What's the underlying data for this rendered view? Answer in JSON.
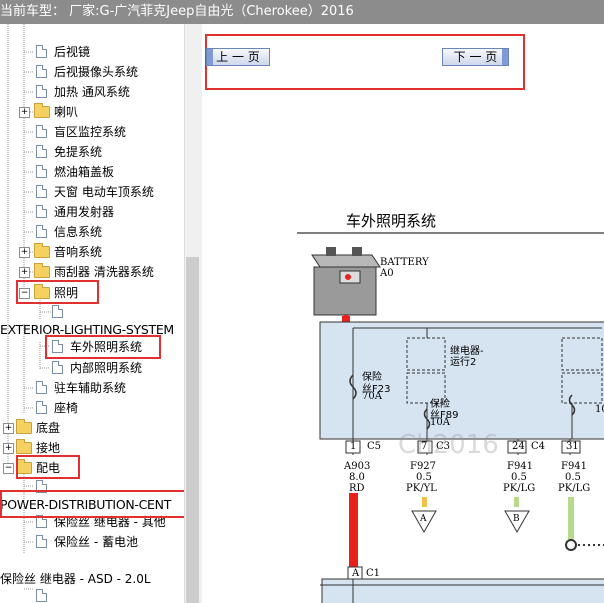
{
  "title_bar": {
    "text": "当前车型： 厂家:G-广汽菲克Jeep自由光（Cherokee）2016"
  },
  "tree": {
    "items": [
      {
        "label": "后视镜",
        "type": "doc"
      },
      {
        "label": "后视摄像头系统",
        "type": "doc"
      },
      {
        "label": "加热 通风系统",
        "type": "doc"
      },
      {
        "label": "喇叭",
        "type": "folder"
      },
      {
        "label": "盲区监控系统",
        "type": "doc"
      },
      {
        "label": "免提系统",
        "type": "doc"
      },
      {
        "label": "燃油箱盖板",
        "type": "doc"
      },
      {
        "label": "天窗 电动车顶系统",
        "type": "doc"
      },
      {
        "label": "通用发射器",
        "type": "doc"
      },
      {
        "label": "信息系统",
        "type": "doc"
      },
      {
        "label": "音响系统",
        "type": "folder"
      },
      {
        "label": "雨刮器 清洗器系统",
        "type": "folder"
      },
      {
        "label": "照明",
        "type": "folder-open"
      },
      {
        "label": "EXTERIOR-LIGHTING-SYSTEM",
        "type": "text"
      },
      {
        "label": "车外照明系统",
        "type": "doc",
        "selected": true
      },
      {
        "label": "内部照明系统",
        "type": "doc"
      },
      {
        "label": "驻车辅助系统",
        "type": "doc"
      },
      {
        "label": "座椅",
        "type": "doc"
      },
      {
        "label": "底盘",
        "type": "folder"
      },
      {
        "label": "接地",
        "type": "folder"
      },
      {
        "label": "配电",
        "type": "folder-open"
      },
      {
        "label": "POWER-DISTRIBUTION-CENT",
        "type": "text"
      },
      {
        "label": "保险丝 继电器 - 其他",
        "type": "doc"
      },
      {
        "label": "保险丝 - 蓄电池",
        "type": "doc"
      },
      {
        "label": "保险丝 继电器 - ASD - 2.0L",
        "type": "text"
      }
    ]
  },
  "nav": {
    "prev_label": "上 一 页",
    "next_label": "下 一 页"
  },
  "diagram": {
    "title": "车外照明系统",
    "battery_label": "BATTERY",
    "battery_id": "A0",
    "fuse1_label": "保险",
    "fuse1_name": "丝F23",
    "fuse1_rating": "70A",
    "relay_label": "继电器-",
    "relay_sub": "运行2",
    "fuse2_label": "保险",
    "fuse2_name": "丝F89",
    "fuse2_rating": "10A",
    "fuse3_rating": "10",
    "connectors": [
      {
        "pin": "1",
        "conn": "C5",
        "circuit": "A903",
        "gauge": "8.0",
        "color": "RD"
      },
      {
        "pin": "7",
        "conn": "C3",
        "circuit": "F927",
        "gauge": "0.5",
        "color": "PK/YL"
      },
      {
        "pin": "24",
        "conn": "C4",
        "circuit": "F941",
        "gauge": "0.5",
        "color": "PK/LG"
      },
      {
        "pin": "31",
        "conn": "",
        "circuit": "F941",
        "gauge": "0.5",
        "color": "PK/LG"
      }
    ],
    "flag_a": "A",
    "flag_b": "B",
    "bottom_pin": "A",
    "bottom_conn": "C1",
    "watermark": "Ch2016"
  },
  "colors": {
    "title_bar": "#8c8c8c",
    "selection": "#e03030",
    "diagram_fill": "#d6e4f2",
    "red_wire": "#e8211c",
    "nav_accent": "#7f9ad6"
  }
}
